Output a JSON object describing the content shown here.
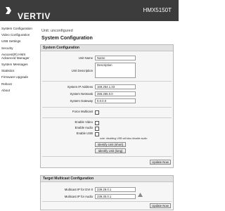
{
  "header": {
    "brand": "VERTIV",
    "model": "HMX5150T",
    "bg_color": "#3c3c3c"
  },
  "sidebar": {
    "items": [
      {
        "label": "System Configuration"
      },
      {
        "label": "Video Configuration"
      },
      {
        "label": "USB Settings"
      },
      {
        "label": "Security"
      },
      {
        "label": "Avocent(R) HMX Advanced Manager"
      },
      {
        "label": "System Messages"
      },
      {
        "label": "Statistics"
      },
      {
        "label": "Firmware Upgrade"
      },
      {
        "label": "Reboot"
      },
      {
        "label": "About"
      }
    ]
  },
  "main": {
    "unit_name": "Unit: unconfigured",
    "page_title": "System Configuration",
    "system_config": {
      "title": "System Configuration",
      "unit_name_label": "Unit Name",
      "unit_name_value": "Name",
      "unit_description_label": "Unit Description",
      "unit_description_value": "Description",
      "ip_label": "System IP Address",
      "ip_value": "169.254.1.33",
      "netmask_label": "System Netmask",
      "netmask_value": "255.255.0.0",
      "gateway_label": "System Gateway",
      "gateway_value": "0.0.0.0",
      "force_multicast_label": "Force Multicast",
      "enable_video_label": "Enable Video",
      "enable_audio_label": "Enable Audio",
      "enable_usb_label": "Enable USB",
      "usb_note": "note: disabling USB will also disable audio",
      "identify_short_label": "Identify Unit (short)",
      "identify_long_label": "Identify Unit (long)",
      "update_label": "Update Now"
    },
    "multicast_config": {
      "title": "Target Multicast Configuration",
      "video_label": "Multicast IP for DVI 0",
      "video_value": "239.28.0.1",
      "audio_label": "Multicast IP for Audio",
      "audio_value": "239.30.0.1",
      "update_label": "Update Now"
    }
  }
}
